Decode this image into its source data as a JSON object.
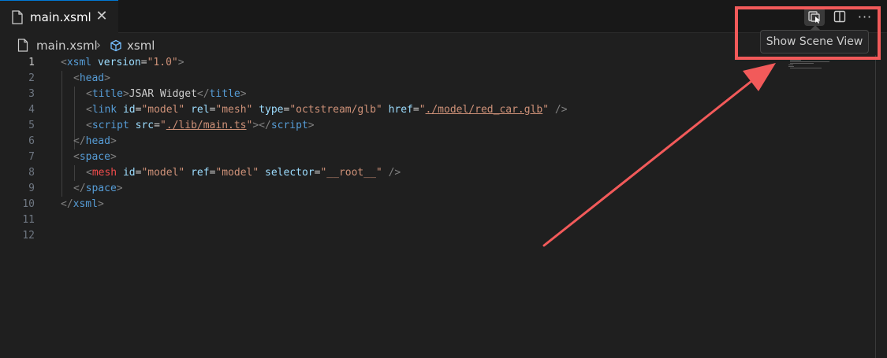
{
  "tab": {
    "title": "main.xsml",
    "close_glyph": "✕"
  },
  "actions": {
    "more_glyph": "···"
  },
  "breadcrumb": {
    "file": "main.xsml",
    "separator": "›",
    "symbol": "xsml"
  },
  "tooltip": {
    "text": "Show Scene View"
  },
  "colors": {
    "background": "#1f1f1f",
    "tag": "#569cd6",
    "custom_tag": "#f14c4c",
    "attribute": "#9cdcfe",
    "string": "#ce9178",
    "annotation": "#f25a5a"
  },
  "icons": [
    "file-icon",
    "close-icon",
    "show-scene-view-icon",
    "split-editor-icon",
    "more-actions-icon",
    "chevron-right-icon",
    "xsml-element-icon"
  ],
  "editor": {
    "active_line": 1,
    "lines": [
      {
        "n": "1",
        "indent": 0,
        "tokens": [
          [
            "<",
            "p"
          ],
          [
            "xsml",
            "tag"
          ],
          [
            " ",
            "txt"
          ],
          [
            "version",
            "attr"
          ],
          [
            "=",
            "txt"
          ],
          [
            "\"1.0\"",
            "str"
          ],
          [
            ">",
            "p"
          ]
        ]
      },
      {
        "n": "2",
        "indent": 1,
        "tokens": [
          [
            "<",
            "p"
          ],
          [
            "head",
            "tag"
          ],
          [
            ">",
            "p"
          ]
        ]
      },
      {
        "n": "3",
        "indent": 2,
        "tokens": [
          [
            "<",
            "p"
          ],
          [
            "title",
            "tag"
          ],
          [
            ">",
            "p"
          ],
          [
            "JSAR Widget",
            "txt"
          ],
          [
            "</",
            "p"
          ],
          [
            "title",
            "tag"
          ],
          [
            ">",
            "p"
          ]
        ]
      },
      {
        "n": "4",
        "indent": 2,
        "tokens": [
          [
            "<",
            "p"
          ],
          [
            "link",
            "tag"
          ],
          [
            " ",
            "txt"
          ],
          [
            "id",
            "attr"
          ],
          [
            "=",
            "txt"
          ],
          [
            "\"model\"",
            "str"
          ],
          [
            " ",
            "txt"
          ],
          [
            "rel",
            "attr"
          ],
          [
            "=",
            "txt"
          ],
          [
            "\"mesh\"",
            "str"
          ],
          [
            " ",
            "txt"
          ],
          [
            "type",
            "attr"
          ],
          [
            "=",
            "txt"
          ],
          [
            "\"octstream/glb\"",
            "str"
          ],
          [
            " ",
            "txt"
          ],
          [
            "href",
            "attr"
          ],
          [
            "=",
            "txt"
          ],
          [
            "\"",
            "str"
          ],
          [
            "./model/red_car.glb",
            "link"
          ],
          [
            "\"",
            "str"
          ],
          [
            " ",
            "txt"
          ],
          [
            "/>",
            "p"
          ]
        ]
      },
      {
        "n": "5",
        "indent": 2,
        "tokens": [
          [
            "<",
            "p"
          ],
          [
            "script",
            "tag"
          ],
          [
            " ",
            "txt"
          ],
          [
            "src",
            "attr"
          ],
          [
            "=",
            "txt"
          ],
          [
            "\"",
            "str"
          ],
          [
            "./lib/main.ts",
            "link"
          ],
          [
            "\"",
            "str"
          ],
          [
            "></",
            "p"
          ],
          [
            "script",
            "tag"
          ],
          [
            ">",
            "p"
          ]
        ]
      },
      {
        "n": "6",
        "indent": 1,
        "tokens": [
          [
            "</",
            "p"
          ],
          [
            "head",
            "tag"
          ],
          [
            ">",
            "p"
          ]
        ]
      },
      {
        "n": "7",
        "indent": 1,
        "tokens": [
          [
            "<",
            "p"
          ],
          [
            "space",
            "tag"
          ],
          [
            ">",
            "p"
          ]
        ]
      },
      {
        "n": "8",
        "indent": 2,
        "tokens": [
          [
            "<",
            "p"
          ],
          [
            "mesh",
            "tag2"
          ],
          [
            " ",
            "txt"
          ],
          [
            "id",
            "attr"
          ],
          [
            "=",
            "txt"
          ],
          [
            "\"model\"",
            "str"
          ],
          [
            " ",
            "txt"
          ],
          [
            "ref",
            "attr"
          ],
          [
            "=",
            "txt"
          ],
          [
            "\"model\"",
            "str"
          ],
          [
            " ",
            "txt"
          ],
          [
            "selector",
            "attr"
          ],
          [
            "=",
            "txt"
          ],
          [
            "\"__root__\"",
            "str"
          ],
          [
            " ",
            "txt"
          ],
          [
            "/>",
            "p"
          ]
        ]
      },
      {
        "n": "9",
        "indent": 1,
        "tokens": [
          [
            "</",
            "p"
          ],
          [
            "space",
            "tag"
          ],
          [
            ">",
            "p"
          ]
        ]
      },
      {
        "n": "10",
        "indent": 0,
        "tokens": [
          [
            "</",
            "p"
          ],
          [
            "xsml",
            "tag"
          ],
          [
            ">",
            "p"
          ]
        ]
      },
      {
        "n": "11",
        "indent": 0,
        "tokens": []
      },
      {
        "n": "12",
        "indent": 0,
        "tokens": []
      }
    ]
  }
}
